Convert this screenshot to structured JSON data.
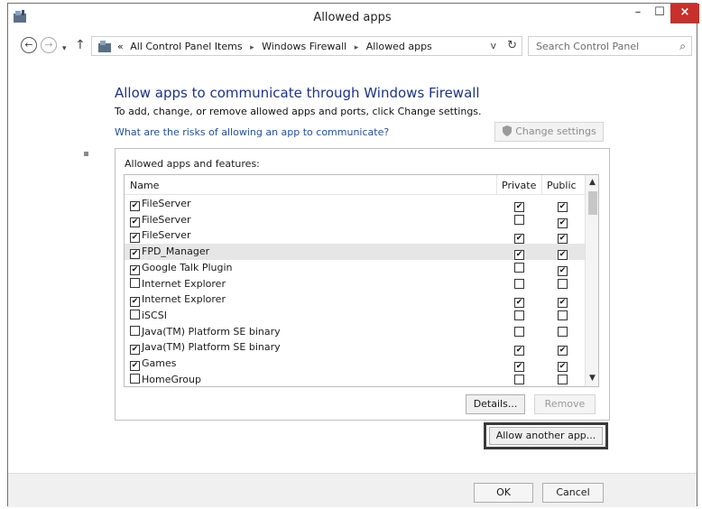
{
  "window": {
    "title": "Allowed apps",
    "controls": {
      "minimize": "–",
      "maximize": "☐",
      "close": "×"
    }
  },
  "nav": {
    "back": "←",
    "forward": "→",
    "recent": "▾",
    "up": "↑",
    "address_prefix": "«",
    "breadcrumb": [
      "All Control Panel Items",
      "Windows Firewall",
      "Allowed apps"
    ],
    "separator": "▸",
    "dropdown": "v",
    "refresh": "↻",
    "search_placeholder": "Search Control Panel",
    "search_icon": "⌕"
  },
  "content": {
    "heading": "Allow apps to communicate through Windows Firewall",
    "subtext": "To add, change, or remove allowed apps and ports, click Change settings.",
    "risk_link": "What are the risks of allowing an app to communicate?",
    "change_settings": "Change settings",
    "group_label": "Allowed apps and features:",
    "columns": {
      "name": "Name",
      "private": "Private",
      "public": "Public"
    },
    "rows": [
      {
        "name": "FileServer",
        "enabled": true,
        "private": true,
        "public": true
      },
      {
        "name": "FileServer",
        "enabled": true,
        "private": false,
        "public": true
      },
      {
        "name": "FileServer",
        "enabled": true,
        "private": true,
        "public": true
      },
      {
        "name": "FPD_Manager",
        "enabled": true,
        "private": true,
        "public": true,
        "selected": true
      },
      {
        "name": "Google Talk Plugin",
        "enabled": true,
        "private": false,
        "public": true
      },
      {
        "name": "Internet Explorer",
        "enabled": false,
        "private": false,
        "public": false
      },
      {
        "name": "Internet Explorer",
        "enabled": true,
        "private": true,
        "public": true
      },
      {
        "name": "iSCSI",
        "enabled": false,
        "private": false,
        "public": false
      },
      {
        "name": "Java(TM) Platform SE binary",
        "enabled": false,
        "private": false,
        "public": false
      },
      {
        "name": "Java(TM) Platform SE binary",
        "enabled": true,
        "private": true,
        "public": true
      },
      {
        "name": "Games",
        "enabled": true,
        "private": true,
        "public": true
      },
      {
        "name": "HomeGroup",
        "enabled": false,
        "private": false,
        "public": false
      }
    ],
    "details_button": "Details...",
    "remove_button": "Remove",
    "allow_another_button": "Allow another app..."
  },
  "footer": {
    "ok": "OK",
    "cancel": "Cancel"
  },
  "icons": {
    "app": "control-panel-icon",
    "shield": "shield-icon",
    "search": "search-icon"
  },
  "colors": {
    "heading": "#1e3287",
    "link": "#1e4fa0",
    "close": "#c7312c"
  }
}
